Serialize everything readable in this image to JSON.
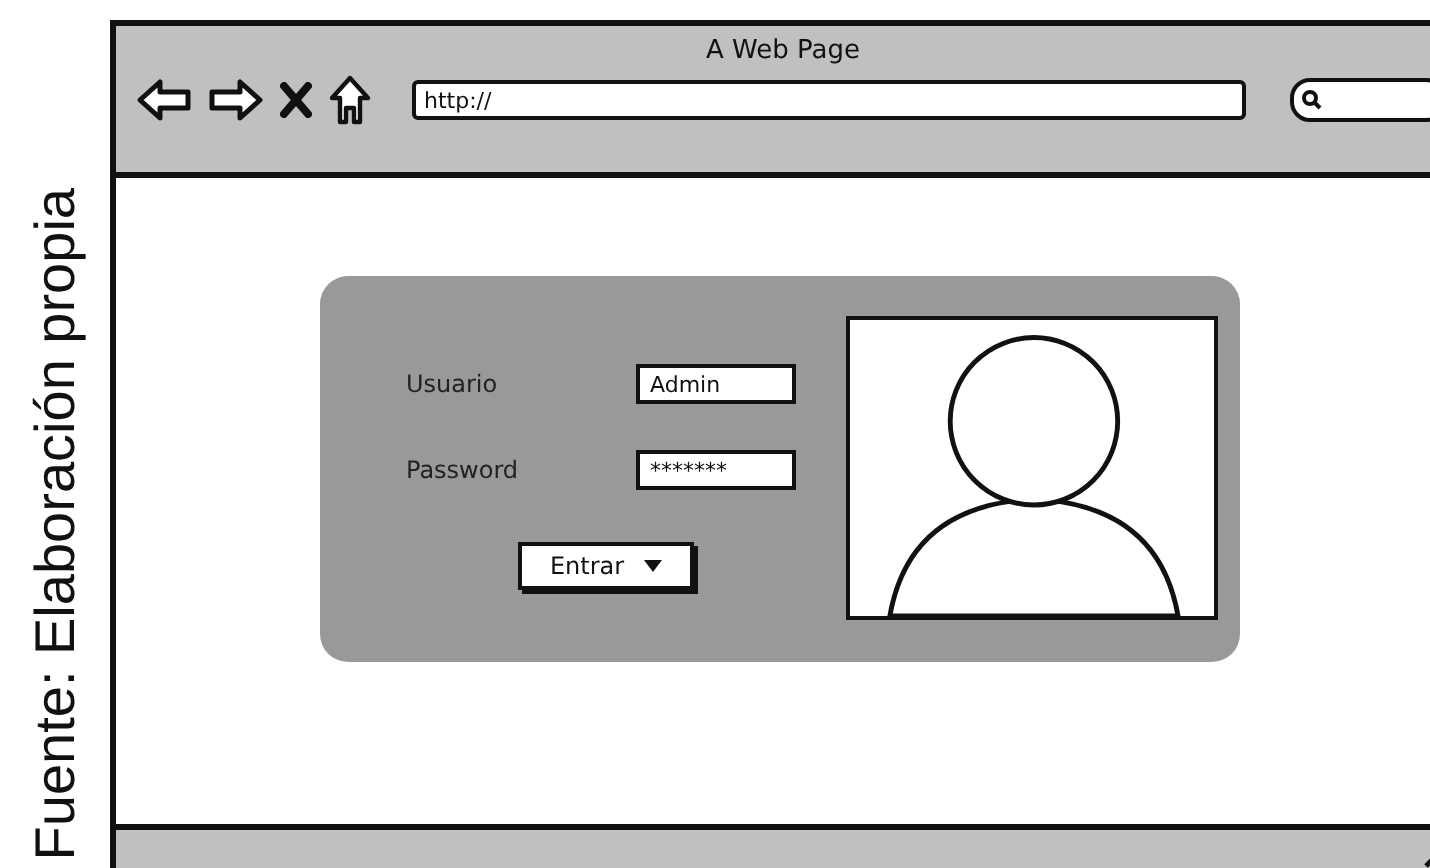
{
  "caption": "Fuente: Elaboración propia",
  "browser": {
    "title": "A Web Page",
    "url": "http://"
  },
  "login": {
    "fields": [
      {
        "label": "Usuario",
        "value": "Admin"
      },
      {
        "label": "Password",
        "value": "*******"
      }
    ],
    "button": {
      "label": "Entrar"
    }
  }
}
